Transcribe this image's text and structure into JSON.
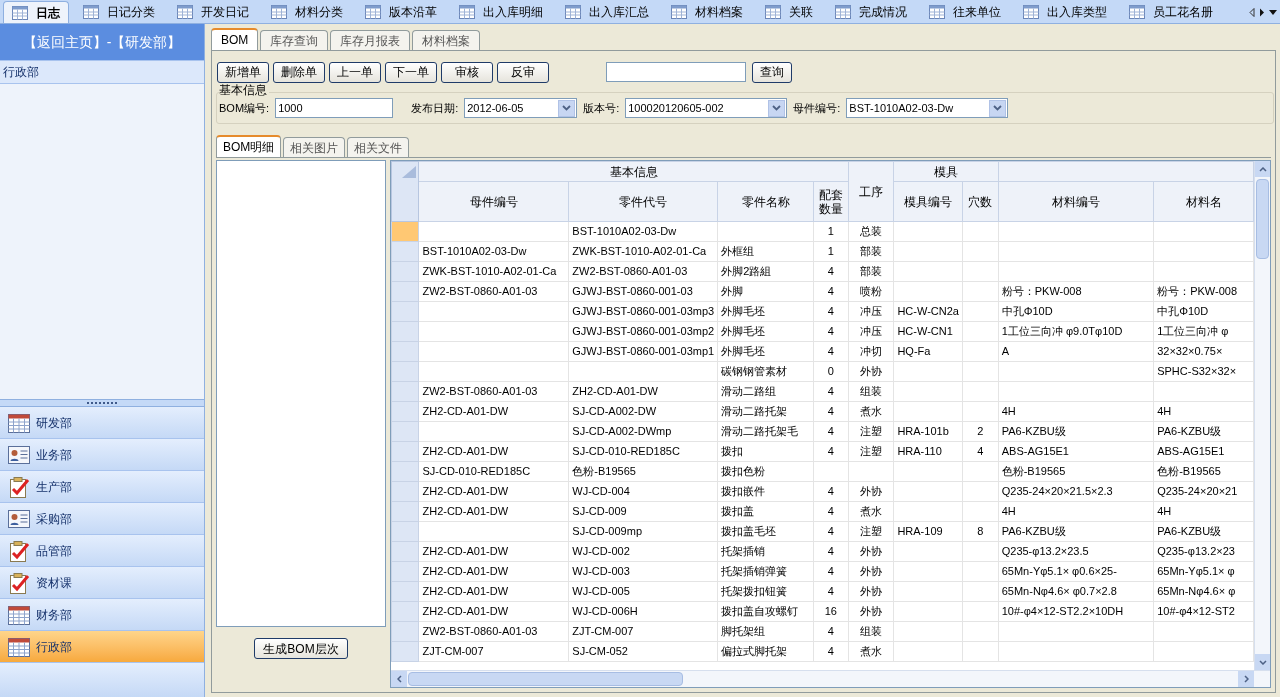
{
  "top_tabs": [
    {
      "label": "日志",
      "selected": true
    },
    {
      "label": "日记分类",
      "selected": false
    },
    {
      "label": "开发日记",
      "selected": false
    },
    {
      "label": "材料分类",
      "selected": false
    },
    {
      "label": "版本沿革",
      "selected": false
    },
    {
      "label": "出入库明细",
      "selected": false
    },
    {
      "label": "出入库汇总",
      "selected": false
    },
    {
      "label": "材料档案",
      "selected": false
    },
    {
      "label": "关联",
      "selected": false
    },
    {
      "label": "完成情况",
      "selected": false
    },
    {
      "label": "往来单位",
      "selected": false
    },
    {
      "label": "出入库类型",
      "selected": false
    },
    {
      "label": "员工花名册",
      "selected": false
    }
  ],
  "sidebar": {
    "header": "【返回主页】-【研发部】",
    "tree_items": [
      {
        "label": "行政部",
        "selected": true
      }
    ],
    "departments": [
      {
        "label": "研发部",
        "kind": "calendar",
        "selected": false
      },
      {
        "label": "业务部",
        "kind": "card",
        "selected": false
      },
      {
        "label": "生产部",
        "kind": "checklist",
        "selected": false
      },
      {
        "label": "采购部",
        "kind": "card",
        "selected": false
      },
      {
        "label": "品管部",
        "kind": "checklist",
        "selected": false
      },
      {
        "label": "资材课",
        "kind": "checklist",
        "selected": false
      },
      {
        "label": "财务部",
        "kind": "calendar",
        "selected": false
      },
      {
        "label": "行政部",
        "kind": "calendar",
        "selected": true
      }
    ]
  },
  "main_tabs": [
    {
      "label": "BOM",
      "selected": true
    },
    {
      "label": "库存查询",
      "selected": false
    },
    {
      "label": "库存月报表",
      "selected": false
    },
    {
      "label": "材料档案",
      "selected": false
    }
  ],
  "toolbar": {
    "buttons": [
      "新增单",
      "删除单",
      "上一单",
      "下一单",
      "审核",
      "反审"
    ],
    "search_button": "查询"
  },
  "basic_info": {
    "title": "基本信息",
    "fields": [
      {
        "label": "BOM编号:",
        "value": "1000",
        "kind": "input"
      },
      {
        "label": "发布日期:",
        "value": "2012-06-05",
        "kind": "dropdown"
      },
      {
        "label": "版本号:",
        "value": "100020120605-002",
        "kind": "dropdown"
      },
      {
        "label": "母件编号:",
        "value": "BST-1010A02-03-Dw",
        "kind": "dropdown"
      }
    ]
  },
  "sub_tabs": [
    {
      "label": "BOM明细",
      "selected": true
    },
    {
      "label": "相关图片",
      "selected": false
    },
    {
      "label": "相关文件",
      "selected": false
    }
  ],
  "generate_button": "生成BOM层次",
  "grid": {
    "column_groups": [
      {
        "kind": "labeled",
        "label": "基本信息",
        "columns": [
          {
            "label": "母件编号",
            "kind": "text"
          },
          {
            "label": "零件代号",
            "kind": "text"
          },
          {
            "label": "零件名称",
            "kind": "text"
          },
          {
            "label": "配套数量",
            "kind": "number"
          }
        ]
      },
      {
        "kind": "tall",
        "columns": [
          {
            "label": "工序",
            "kind": "center"
          }
        ]
      },
      {
        "kind": "labeled",
        "label": "模具",
        "columns": [
          {
            "label": "模具编号",
            "kind": "text"
          },
          {
            "label": "穴数",
            "kind": "number"
          }
        ]
      },
      {
        "kind": "blank",
        "columns": [
          {
            "label": "材料编号",
            "kind": "text"
          },
          {
            "label": "材料名",
            "kind": "text"
          }
        ]
      }
    ],
    "rows": [
      {
        "selected": true,
        "cells": [
          null,
          "BST-1010A02-03-Dw",
          null,
          "1",
          "总装",
          null,
          null,
          null,
          null
        ]
      },
      {
        "selected": false,
        "cells": [
          "BST-1010A02-03-Dw",
          "ZWK-BST-1010-A02-01-Ca",
          "外框组",
          "1",
          "部装",
          null,
          null,
          null,
          null
        ]
      },
      {
        "selected": false,
        "cells": [
          "ZWK-BST-1010-A02-01-Ca",
          "ZW2-BST-0860-A01-03",
          "外脚2路組",
          "4",
          "部装",
          null,
          null,
          null,
          null
        ]
      },
      {
        "selected": false,
        "cells": [
          "ZW2-BST-0860-A01-03",
          "GJWJ-BST-0860-001-03",
          "外脚",
          "4",
          "喷粉",
          null,
          null,
          "粉号：PKW-008",
          "粉号：PKW-008"
        ]
      },
      {
        "selected": false,
        "cells": [
          null,
          "GJWJ-BST-0860-001-03mp3",
          "外脚毛坯",
          "4",
          "冲压",
          "HC-W-CN2a",
          null,
          "中孔Φ10D",
          "中孔Φ10D"
        ]
      },
      {
        "selected": false,
        "cells": [
          null,
          "GJWJ-BST-0860-001-03mp2",
          "外脚毛坯",
          "4",
          "冲压",
          "HC-W-CN1",
          null,
          "1工位三向冲 φ9.0Tφ10D",
          "1工位三向冲 φ"
        ]
      },
      {
        "selected": false,
        "cells": [
          null,
          "GJWJ-BST-0860-001-03mp1",
          "外脚毛坯",
          "4",
          "冲切",
          "HQ-Fa",
          null,
          "A",
          "32×32×0.75×"
        ]
      },
      {
        "selected": false,
        "cells": [
          null,
          null,
          "碳钢钢管素材",
          "0",
          "外协",
          null,
          null,
          null,
          "SPHC-S32×32×"
        ]
      },
      {
        "selected": false,
        "cells": [
          "ZW2-BST-0860-A01-03",
          "ZH2-CD-A01-DW",
          "滑动二路组",
          "4",
          "组装",
          null,
          null,
          null,
          null
        ]
      },
      {
        "selected": false,
        "cells": [
          "ZH2-CD-A01-DW",
          "SJ-CD-A002-DW",
          "滑动二路托架",
          "4",
          "煮水",
          null,
          null,
          "4H",
          "4H"
        ]
      },
      {
        "selected": false,
        "cells": [
          null,
          "SJ-CD-A002-DWmp",
          "滑动二路托架毛",
          "4",
          "注塑",
          "HRA-101b",
          "2",
          "PA6-KZBU级",
          "PA6-KZBU级"
        ]
      },
      {
        "selected": false,
        "cells": [
          "ZH2-CD-A01-DW",
          "SJ-CD-010-RED185C",
          "拨扣",
          "4",
          "注塑",
          "HRA-110",
          "4",
          "ABS-AG15E1",
          "ABS-AG15E1"
        ]
      },
      {
        "selected": false,
        "cells": [
          "SJ-CD-010-RED185C",
          "色粉-B19565",
          "拨扣色粉",
          null,
          null,
          null,
          null,
          "色粉-B19565",
          "色粉-B19565"
        ]
      },
      {
        "selected": false,
        "cells": [
          "ZH2-CD-A01-DW",
          "WJ-CD-004",
          "拨扣嵌件",
          "4",
          "外协",
          null,
          null,
          "Q235-24×20×21.5×2.3",
          "Q235-24×20×21"
        ]
      },
      {
        "selected": false,
        "cells": [
          "ZH2-CD-A01-DW",
          "SJ-CD-009",
          "拨扣盖",
          "4",
          "煮水",
          null,
          null,
          "4H",
          "4H"
        ]
      },
      {
        "selected": false,
        "cells": [
          null,
          "SJ-CD-009mp",
          "拨扣盖毛坯",
          "4",
          "注塑",
          "HRA-109",
          "8",
          "PA6-KZBU级",
          "PA6-KZBU级"
        ]
      },
      {
        "selected": false,
        "cells": [
          "ZH2-CD-A01-DW",
          "WJ-CD-002",
          "托架插销",
          "4",
          "外协",
          null,
          null,
          "Q235-φ13.2×23.5",
          "Q235-φ13.2×23"
        ]
      },
      {
        "selected": false,
        "cells": [
          "ZH2-CD-A01-DW",
          "WJ-CD-003",
          "托架插销弹簧",
          "4",
          "外协",
          null,
          null,
          "65Mn-Yφ5.1× φ0.6×25-",
          "65Mn-Yφ5.1× φ"
        ]
      },
      {
        "selected": false,
        "cells": [
          "ZH2-CD-A01-DW",
          "WJ-CD-005",
          "托架拨扣钮簧",
          "4",
          "外协",
          null,
          null,
          "65Mn-Nφ4.6× φ0.7×2.8",
          "65Mn-Nφ4.6× φ"
        ]
      },
      {
        "selected": false,
        "cells": [
          "ZH2-CD-A01-DW",
          "WJ-CD-006H",
          "拨扣盖自攻螺钉",
          "16",
          "外协",
          null,
          null,
          "10#-φ4×12-ST2.2×10DH",
          "10#-φ4×12-ST2"
        ]
      },
      {
        "selected": false,
        "cells": [
          "ZW2-BST-0860-A01-03",
          "ZJT-CM-007",
          "脚托架组",
          "4",
          "组装",
          null,
          null,
          null,
          null
        ]
      },
      {
        "selected": false,
        "cells": [
          "ZJT-CM-007",
          "SJ-CM-052",
          "偏拉式脚托架",
          "4",
          "煮水",
          null,
          null,
          null,
          null
        ]
      }
    ]
  }
}
